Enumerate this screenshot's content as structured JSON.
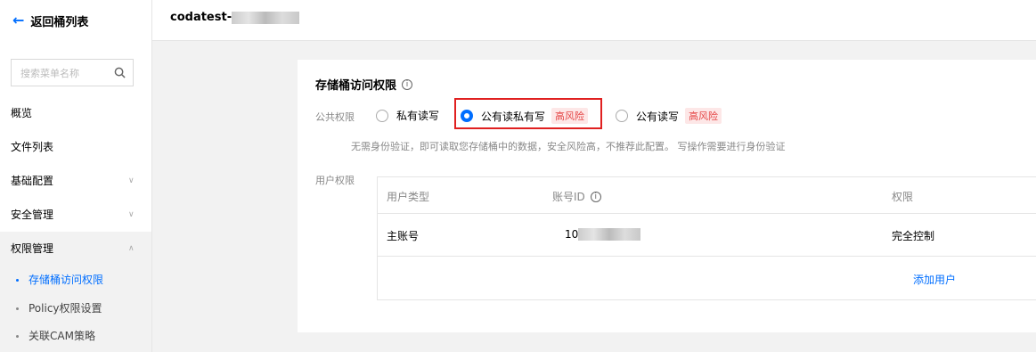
{
  "sidebar": {
    "back_label": "返回桶列表",
    "search_placeholder": "搜索菜单名称",
    "items": [
      {
        "label": "概览"
      },
      {
        "label": "文件列表"
      },
      {
        "label": "基础配置"
      },
      {
        "label": "安全管理"
      },
      {
        "label": "权限管理"
      }
    ],
    "sub_items": [
      {
        "label": "存储桶访问权限",
        "active": true
      },
      {
        "label": "Policy权限设置"
      },
      {
        "label": "关联CAM策略"
      }
    ]
  },
  "header": {
    "bucket_name_prefix": "codatest-"
  },
  "card": {
    "title": "存储桶访问权限",
    "public_label": "公共权限",
    "radios": [
      {
        "label": "私有读写",
        "checked": false
      },
      {
        "label": "公有读私有写",
        "checked": true,
        "risk": "高风险"
      },
      {
        "label": "公有读写",
        "checked": false,
        "risk": "高风险"
      }
    ],
    "description": "无需身份验证，即可读取您存储桶中的数据，安全风险高，不推荐此配置。 写操作需要进行身份验证",
    "user_label": "用户权限",
    "table": {
      "headers": [
        "用户类型",
        "账号ID",
        "权限"
      ],
      "rows": [
        {
          "type": "主账号",
          "id_prefix": "10",
          "permission": "完全控制"
        }
      ],
      "add_user": "添加用户"
    }
  },
  "colors": {
    "accent": "#006eff",
    "risk_text": "#e54545",
    "risk_bg": "#fde7e7",
    "highlight": "#e02020"
  }
}
